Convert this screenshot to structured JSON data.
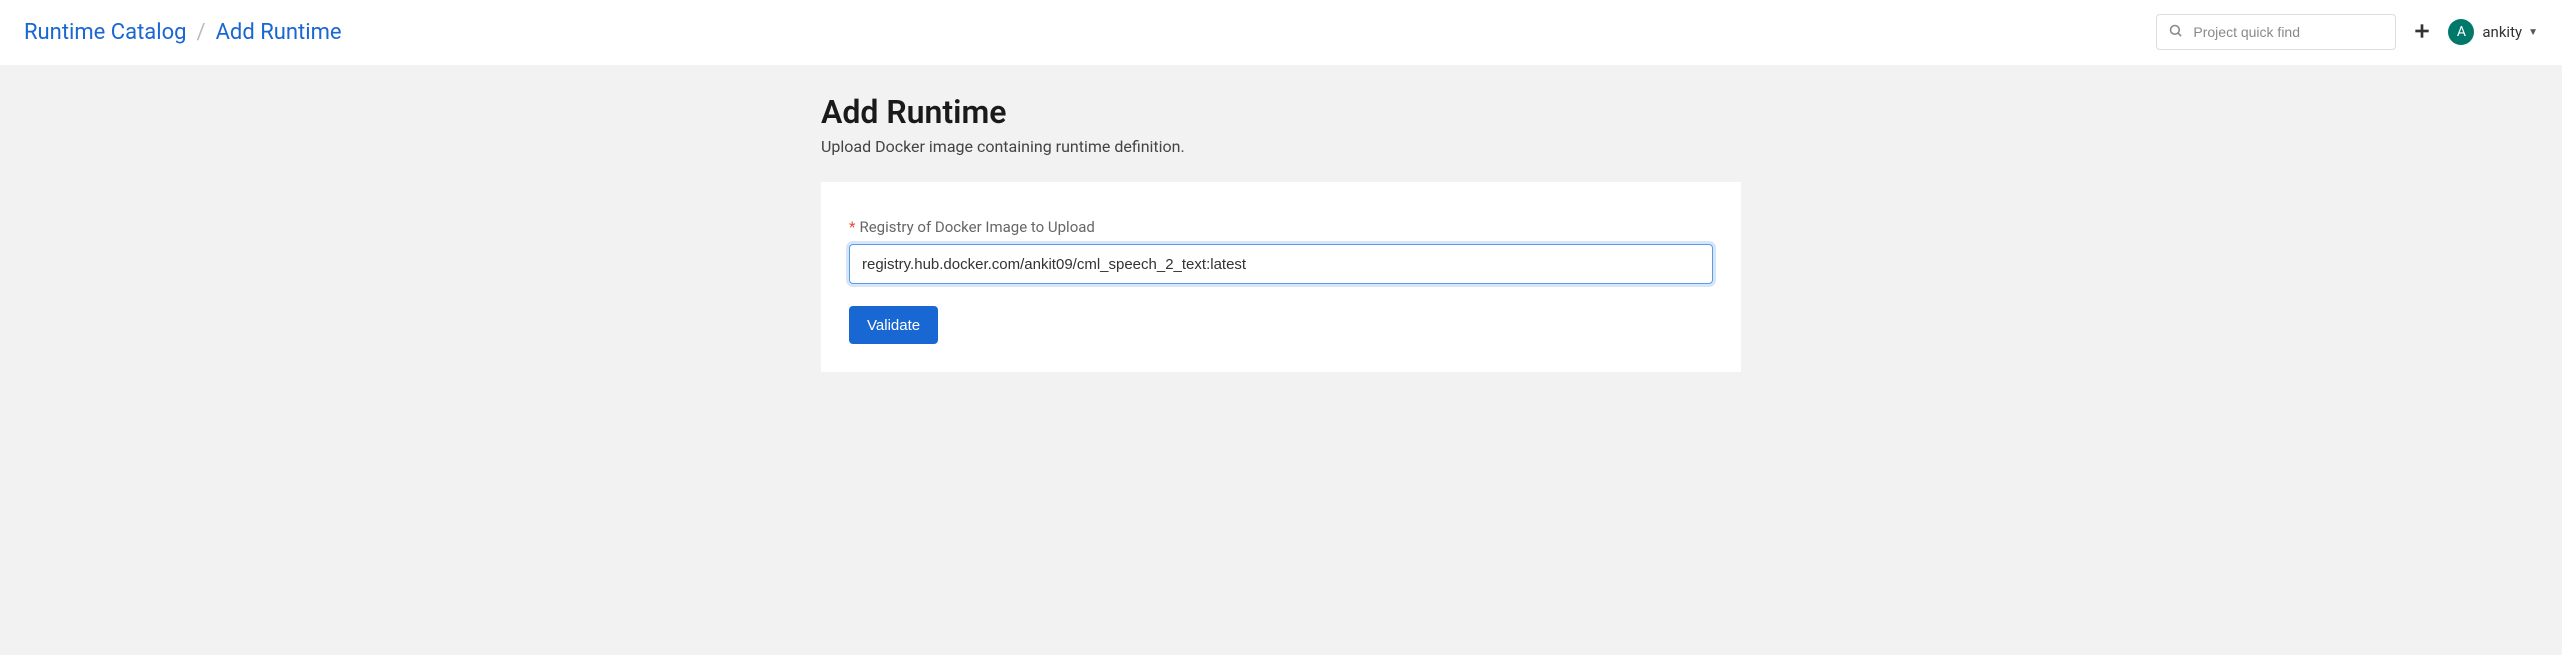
{
  "breadcrumb": {
    "root": "Runtime Catalog",
    "current": "Add Runtime"
  },
  "search": {
    "placeholder": "Project quick find"
  },
  "user": {
    "initial": "A",
    "name": "ankity"
  },
  "page": {
    "title": "Add Runtime",
    "subtitle": "Upload Docker image containing runtime definition."
  },
  "form": {
    "registry_label": "Registry of Docker Image to Upload",
    "registry_value": "registry.hub.docker.com/ankit09/cml_speech_2_text:latest",
    "validate_label": "Validate"
  }
}
